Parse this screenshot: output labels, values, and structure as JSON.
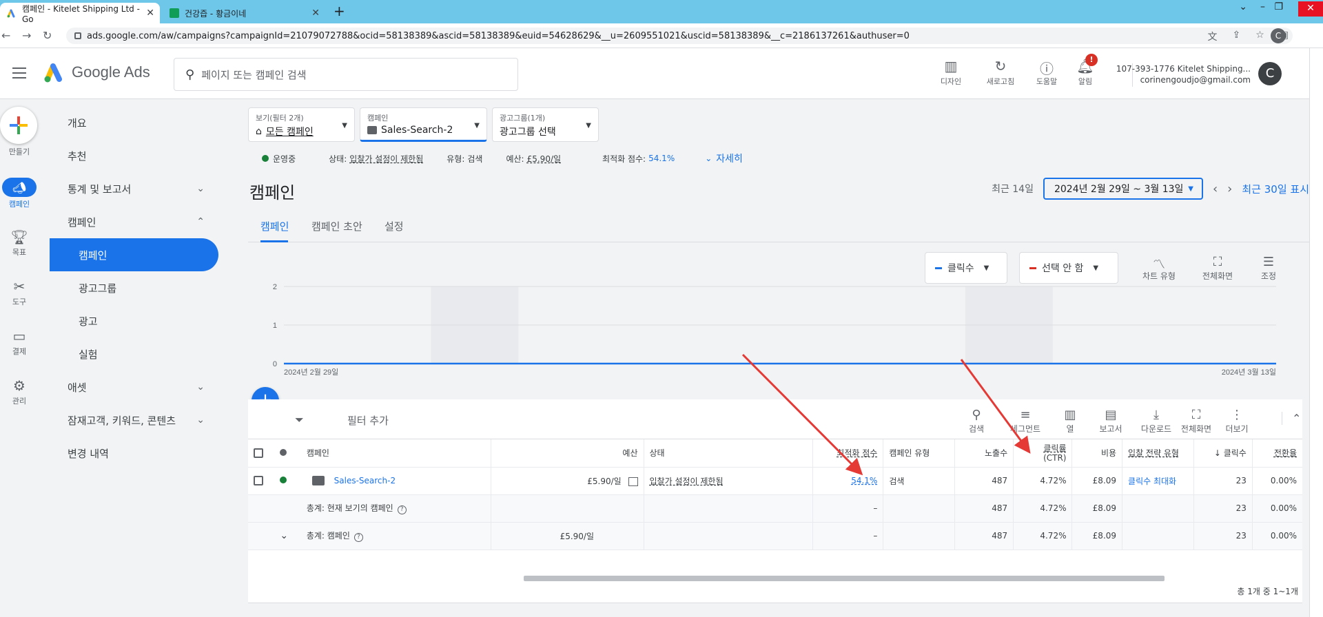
{
  "browser": {
    "tabs": [
      {
        "title": "캠페인 - Kitelet Shipping Ltd - Go"
      },
      {
        "title": "건강즙 - 황금이네"
      }
    ],
    "url": "ads.google.com/aw/campaigns?campaignId=21079072788&ocid=58138389&ascid=58138389&euid=54628629&__u=2609551021&uscid=58138389&__c=2186137261&authuser=0",
    "profile_initial": "C"
  },
  "header": {
    "logo_text": "Google Ads",
    "search_placeholder": "페이지 또는 캠페인 검색",
    "actions": [
      {
        "label": "디자인",
        "icon": "design-icon"
      },
      {
        "label": "새로고침",
        "icon": "refresh-icon"
      },
      {
        "label": "도움말",
        "icon": "help-icon"
      },
      {
        "label": "알림",
        "icon": "bell-icon"
      }
    ],
    "notification_badge": "!",
    "account_line1": "107-393-1776 Kitelet Shipping...",
    "account_line2": "corinengoudjo@gmail.com",
    "account_initial": "C"
  },
  "rail": {
    "create_label": "만들기",
    "items": [
      {
        "label": "캠페인",
        "icon": "campaign-icon"
      },
      {
        "label": "목표",
        "icon": "trophy-icon"
      },
      {
        "label": "도구",
        "icon": "tools-icon"
      },
      {
        "label": "결제",
        "icon": "billing-icon"
      },
      {
        "label": "관리",
        "icon": "settings-icon"
      }
    ]
  },
  "sidenav": {
    "items": [
      {
        "label": "개요"
      },
      {
        "label": "추천"
      },
      {
        "label": "통계 및 보고서"
      },
      {
        "label": "캠페인"
      },
      {
        "label": "캠페인"
      },
      {
        "label": "광고그룹"
      },
      {
        "label": "광고"
      },
      {
        "label": "실험"
      },
      {
        "label": "애셋"
      },
      {
        "label": "잠재고객, 키워드, 콘텐츠"
      },
      {
        "label": "변경 내역"
      }
    ]
  },
  "scope": {
    "view": {
      "label": "보기(필터 2개)",
      "value": "모든 캠페인"
    },
    "campaign": {
      "label": "캠페인",
      "value": "Sales-Search-2"
    },
    "adgroup": {
      "label": "광고그룹(1개)",
      "value": "광고그룹 선택"
    }
  },
  "status_line": {
    "state": "운영중",
    "status_label": "상태:",
    "status_value": "입찰가 설정이 제한됨",
    "type_label": "유형:",
    "type_value": "검색",
    "budget_label": "예산:",
    "budget_value": "£5.90/일",
    "opt_label": "최적화 점수:",
    "opt_value": "54.1%",
    "details": "자세히"
  },
  "page": {
    "title": "캠페인",
    "date_range_label": "최근 14일",
    "date_range": "2024년 2월 29일 ~ 3월 13일",
    "show_30": "최근 30일 표시"
  },
  "subtabs": [
    "캠페인",
    "캠페인 초안",
    "설정"
  ],
  "chart": {
    "metric1": "클릭수",
    "metric2": "선택 안 함",
    "tools": [
      {
        "label": "차트 유형",
        "icon": "chart-type-icon"
      },
      {
        "label": "전체화면",
        "icon": "fullscreen-icon"
      },
      {
        "label": "조정",
        "icon": "adjust-icon"
      }
    ],
    "colors": {
      "metric1": "#1a73e8",
      "metric2": "#d93025"
    }
  },
  "chart_data": {
    "type": "line",
    "x_start_label": "2024년 2월 29일",
    "x_end_label": "2024년 3월 13일",
    "yticks": [
      "2",
      "1",
      "0"
    ],
    "ylim": [
      0,
      2
    ],
    "series": [
      {
        "name": "클릭수",
        "values": [
          0,
          0,
          0,
          0,
          0,
          0,
          0,
          0,
          0,
          0,
          0,
          0,
          0,
          0
        ]
      }
    ]
  },
  "table_toolbar": {
    "filter_add": "필터 추가",
    "tools": [
      {
        "label": "검색",
        "icon": "search-icon"
      },
      {
        "label": "세그먼트",
        "icon": "segment-icon"
      },
      {
        "label": "열",
        "icon": "columns-icon"
      },
      {
        "label": "보고서",
        "icon": "report-icon"
      },
      {
        "label": "다운로드",
        "icon": "download-icon"
      },
      {
        "label": "전체화면",
        "icon": "fullscreen-icon"
      },
      {
        "label": "더보기",
        "icon": "more-icon"
      }
    ]
  },
  "table": {
    "headers": {
      "campaign": "캠페인",
      "budget": "예산",
      "status": "상태",
      "opt": "최적화 점수",
      "type": "캠페인 유형",
      "impr": "노출수",
      "ctr1": "클릭률",
      "ctr2": "(CTR)",
      "cost": "비용",
      "bid": "입찰 전략 유형",
      "clicks": "↓ 클릭수",
      "conv": "전환율"
    },
    "row": {
      "campaign": "Sales-Search-2",
      "budget": "£5.90/일",
      "status": "입찰가 설정이 제한됨",
      "opt": "54.1%",
      "type": "검색",
      "impr": "487",
      "ctr": "4.72%",
      "cost": "£8.09",
      "bid": "클릭수 최대화",
      "clicks": "23",
      "conv": "0.00%"
    },
    "total_view": {
      "label": "총계: 현재 보기의 캠페인",
      "opt": "–",
      "impr": "487",
      "ctr": "4.72%",
      "cost": "£8.09",
      "clicks": "23",
      "conv": "0.00%"
    },
    "total_all": {
      "label": "총계: 캠페인",
      "budget": "£5.90/일",
      "opt": "–",
      "impr": "487",
      "ctr": "4.72%",
      "cost": "£8.09",
      "clicks": "23",
      "conv": "0.00%"
    },
    "pagination": "총 1개 중 1~1개"
  }
}
